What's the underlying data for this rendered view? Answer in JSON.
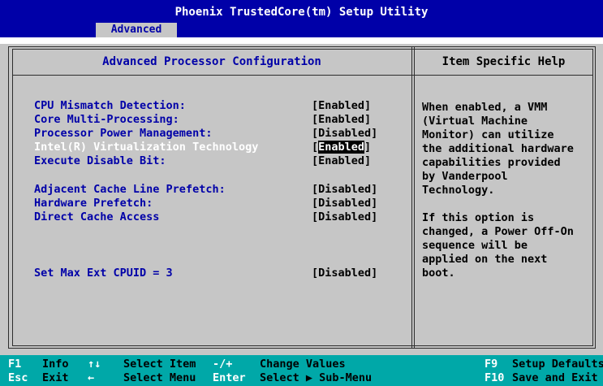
{
  "title": "Phoenix TrustedCore(tm) Setup Utility",
  "tabs": [
    {
      "label": "Advanced"
    }
  ],
  "panel": {
    "title": "Advanced Processor Configuration"
  },
  "help_panel": {
    "title": "Item Specific Help",
    "lines": [
      "When enabled, a VMM",
      "(Virtual Machine",
      "Monitor) can utilize",
      "the additional hardware",
      "capabilities provided",
      "by Vanderpool",
      "Technology.",
      "",
      "If this option is",
      "changed, a Power Off-On",
      "sequence will be",
      "applied on the next",
      "boot."
    ]
  },
  "settings": [
    {
      "label": "CPU Mismatch Detection:",
      "value": "[Enabled]"
    },
    {
      "label": "Core Multi-Processing:",
      "value": "[Enabled]"
    },
    {
      "label": "Processor Power Management:",
      "value": "[Disabled]"
    },
    {
      "label": "Intel(R) Virtualization Technology",
      "value_open": "[",
      "value_text": "Enabled",
      "value_close": "]",
      "selected": true
    },
    {
      "label": "Execute Disable Bit:",
      "value": "[Enabled]"
    },
    {
      "label": "Adjacent Cache Line Prefetch:",
      "value": "[Disabled]"
    },
    {
      "label": "Hardware Prefetch:",
      "value": "[Disabled]"
    },
    {
      "label": "Direct Cache Access",
      "value": "[Disabled]"
    },
    {
      "label": "Set Max Ext CPUID = 3",
      "value": "[Disabled]"
    }
  ],
  "footer": {
    "row1": [
      {
        "key": "F1",
        "desc": "Info"
      },
      {
        "key": "↑↓",
        "desc": "Select Item"
      },
      {
        "key": "-/+",
        "desc": "Change Values"
      },
      {
        "key": "F9",
        "desc": "Setup Defaults"
      }
    ],
    "row2": [
      {
        "key": "Esc",
        "desc": "Exit"
      },
      {
        "key": "←",
        "desc": "Select Menu"
      },
      {
        "key": "Enter",
        "desc": "Select ▶ Sub-Menu"
      },
      {
        "key": "F10",
        "desc": "Save and Exit"
      }
    ]
  },
  "colors": {
    "bios_blue": "#0000a8",
    "background_gray": "#c6c6c6",
    "footer_cyan": "#00a8a8",
    "text_white": "#ffffff",
    "text_black": "#000000"
  }
}
